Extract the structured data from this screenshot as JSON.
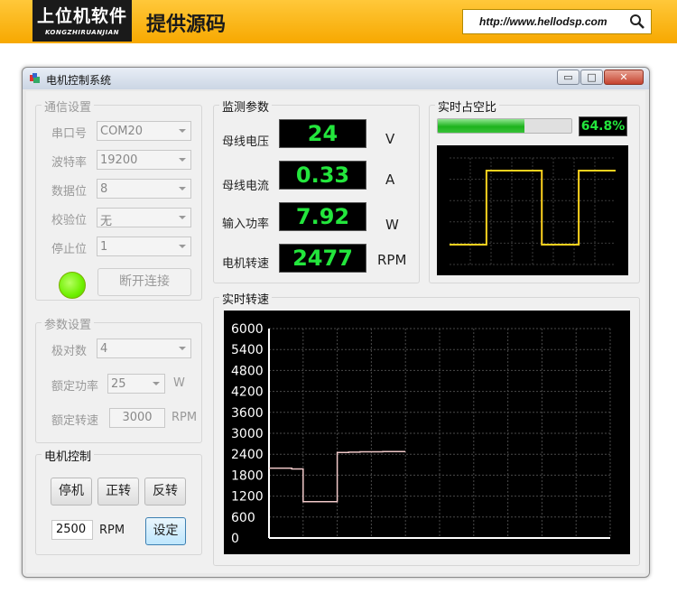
{
  "banner": {
    "brand_main": "上位机软件",
    "brand_sub": "KONGZHIRUANJIAN",
    "slogan": "提供源码",
    "url": "http://www.hellodsp.com"
  },
  "window": {
    "title": "电机控制系统",
    "buttons": {
      "minimize": "▭",
      "maximize": "□",
      "close": "✕"
    }
  },
  "comm": {
    "group_label": "通信设置",
    "rows": [
      {
        "label": "串口号",
        "value": "COM20"
      },
      {
        "label": "波特率",
        "value": "19200"
      },
      {
        "label": "数据位",
        "value": "8"
      },
      {
        "label": "校验位",
        "value": "无"
      },
      {
        "label": "停止位",
        "value": "1"
      }
    ],
    "disconnect_label": "断开连接",
    "led_color": "#6ef000"
  },
  "params": {
    "group_label": "参数设置",
    "pole_label": "极对数",
    "pole_value": "4",
    "power_label": "额定功率",
    "power_value": "25",
    "power_unit": "W",
    "speed_label": "额定转速",
    "speed_value": "3000",
    "speed_unit": "RPM"
  },
  "motor": {
    "group_label": "电机控制",
    "stop_label": "停机",
    "forward_label": "正转",
    "reverse_label": "反转",
    "rpm_value": "2500",
    "rpm_unit": "RPM",
    "set_label": "设定"
  },
  "monitor": {
    "group_label": "监测参数",
    "items": [
      {
        "label": "母线电压",
        "value": "24",
        "unit": "V"
      },
      {
        "label": "母线电流",
        "value": "0.33",
        "unit": "A"
      },
      {
        "label": "输入功率",
        "value": "7.92",
        "unit": "W"
      },
      {
        "label": "电机转速",
        "value": "2477",
        "unit": "RPM"
      }
    ],
    "lcd_color": "#23e63c"
  },
  "duty": {
    "group_label": "实时占空比",
    "percent_text": "64.8%",
    "fraction": 0.648,
    "trace_color": "#ffd21e"
  },
  "speed_chart": {
    "group_label": "实时转速",
    "line_color": "#f0c8c8"
  },
  "chart_data": [
    {
      "type": "line",
      "title": "实时转速",
      "xlabel": "",
      "ylabel": "",
      "ylim": [
        0,
        6000
      ],
      "yticks": [
        0,
        600,
        1200,
        1800,
        2400,
        3000,
        3600,
        4200,
        4800,
        5400,
        6000
      ],
      "grid": true,
      "x": [
        0,
        5,
        10,
        15,
        20,
        25,
        30,
        35,
        40,
        45,
        50,
        55,
        60
      ],
      "series": [
        {
          "values": [
            2000,
            2000,
            1980,
            1040,
            1040,
            1040,
            2450,
            2460,
            2470,
            2470,
            2475,
            2477,
            2477
          ]
        }
      ]
    },
    {
      "type": "line",
      "title": "实时占空比",
      "grid": true,
      "x": [
        0,
        1,
        2,
        3,
        4,
        5,
        6,
        7,
        8,
        9
      ],
      "series": [
        {
          "values": [
            0,
            0,
            1,
            1,
            1,
            0,
            0,
            1,
            1,
            1
          ]
        }
      ]
    }
  ]
}
